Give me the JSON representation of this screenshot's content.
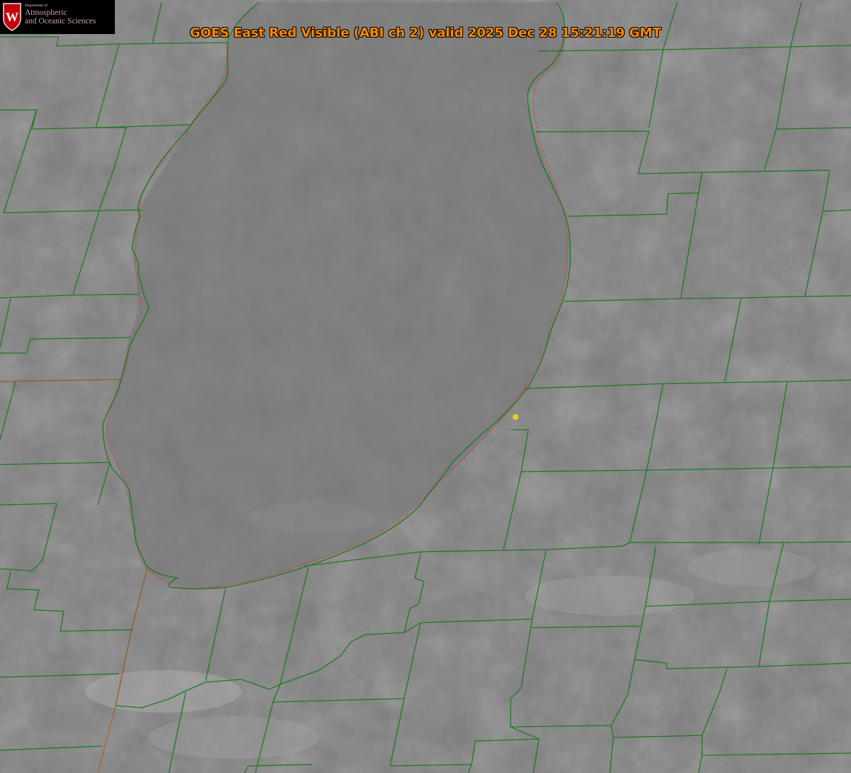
{
  "title": "GOES East Red Visible (ABI ch 2) valid 2025 Dec 28 15:21:19 GMT",
  "logo": {
    "department": "Department of",
    "line1": "Atmospheric",
    "line2": "and Oceanic Sciences",
    "crest_letter": "W"
  },
  "colors": {
    "county_borders": "#1f7a1f",
    "state_border": "#b05a2a",
    "lake_outline_dotted": "#e03030",
    "station_marker": "#e6d219",
    "title_text": "#ff8a00",
    "logo_crest": "#c5050c"
  },
  "layers": [
    "visible-satellite-imagery",
    "lake-shoreline",
    "county-borders",
    "state-border",
    "station-marker"
  ]
}
